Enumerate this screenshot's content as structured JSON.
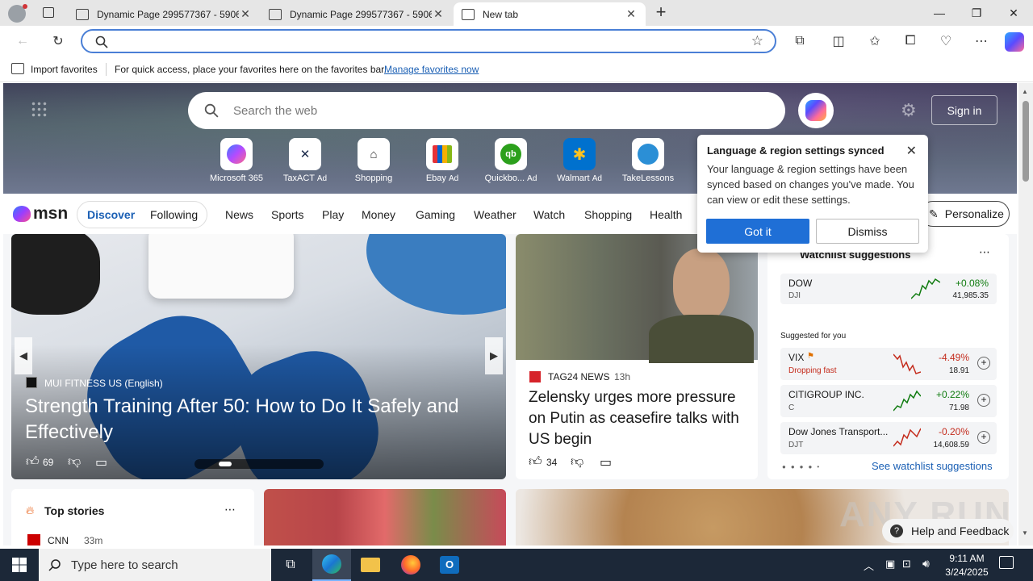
{
  "tabs": [
    {
      "title": "Dynamic Page 299577367 - 5906..."
    },
    {
      "title": "Dynamic Page 299577367 - 5906..."
    },
    {
      "title": "New tab"
    }
  ],
  "address": {
    "value": ""
  },
  "favbar": {
    "import_label": "Import favorites",
    "hint": "For quick access, place your favorites here on the favorites bar.",
    "manage_link": "Manage favorites now"
  },
  "hero": {
    "search_placeholder": "Search the web",
    "signin": "Sign in",
    "quicklinks": [
      {
        "label": "Microsoft 365",
        "ad": ""
      },
      {
        "label": "TaxACT",
        "ad": "Ad"
      },
      {
        "label": "Shopping",
        "ad": ""
      },
      {
        "label": "Ebay",
        "ad": "Ad"
      },
      {
        "label": "Quickbo...",
        "ad": "Ad"
      },
      {
        "label": "Walmart",
        "ad": "Ad"
      },
      {
        "label": "TakeLessons",
        "ad": ""
      }
    ]
  },
  "msn": {
    "logo": "msn",
    "discover": "Discover",
    "following": "Following",
    "links": [
      "News",
      "Sports",
      "Play",
      "Money",
      "Gaming",
      "Weather",
      "Watch",
      "Shopping",
      "Health"
    ],
    "personalize": "Personalize"
  },
  "popup": {
    "title": "Language & region settings synced",
    "body": "Your language & region settings have been synced based on changes you've made. You can view or edit these settings.",
    "got_it": "Got it",
    "dismiss": "Dismiss"
  },
  "feature": {
    "source": "MUI FITNESS US (English)",
    "headline": "Strength Training After 50: How to Do It Safely and Effectively",
    "likes": "69"
  },
  "news": {
    "source": "TAG24 NEWS",
    "time": "13h",
    "headline": "Zelensky urges more pressure on Putin as ceasefire talks with US begin",
    "likes": "34"
  },
  "watchlist": {
    "title": "Watchlist suggestions",
    "suggested": "Suggested for you",
    "see_more": "See watchlist suggestions",
    "items": [
      {
        "name": "DOW",
        "sym": "DJI",
        "change": "+0.08%",
        "price": "41,985.35",
        "note": "",
        "color": "#0f7b0f"
      },
      {
        "name": "VIX",
        "sym": "",
        "change": "-4.49%",
        "price": "18.91",
        "note": "Dropping fast",
        "color": "#c42b1c"
      },
      {
        "name": "CITIGROUP INC.",
        "sym": "C",
        "change": "+0.22%",
        "price": "71.98",
        "note": "",
        "color": "#0f7b0f"
      },
      {
        "name": "Dow Jones Transport...",
        "sym": "DJT",
        "change": "-0.20%",
        "price": "14,608.59",
        "note": "",
        "color": "#c42b1c"
      }
    ]
  },
  "top_stories": {
    "title": "Top stories",
    "source": "CNN",
    "time": "33m"
  },
  "help": "Help and Feedback",
  "watermark": "ANY RUN",
  "taskbar": {
    "search": "Type here to search",
    "time": "9:11 AM",
    "date": "3/24/2025"
  }
}
